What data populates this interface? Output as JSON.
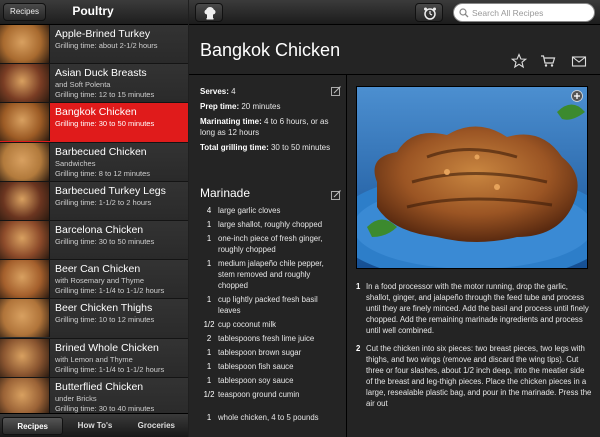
{
  "left_panel": {
    "back_label": "Recipes",
    "title": "Poultry",
    "recipes": [
      {
        "title": "Apple-Brined Turkey",
        "subtitle": "",
        "meta": "Grilling time: about 2-1/2 hours",
        "active": false,
        "thumb": "#a86a2f"
      },
      {
        "title": "Asian Duck Breasts",
        "subtitle": "and Soft Polenta",
        "meta": "Grilling time: 12 to 15 minutes",
        "active": false,
        "thumb": "#7a3d24"
      },
      {
        "title": "Bangkok Chicken",
        "subtitle": "",
        "meta": "Grilling time: 30 to 50 minutes",
        "active": true,
        "thumb": "#9c5b25"
      },
      {
        "title": "Barbecued Chicken",
        "subtitle": "Sandwiches",
        "meta": "Grilling time: 8 to 12 minutes",
        "active": false,
        "thumb": "#b27a3c"
      },
      {
        "title": "Barbecued Turkey Legs",
        "subtitle": "",
        "meta": "Grilling time: 1-1/2 to 2 hours",
        "active": false,
        "thumb": "#6b3520"
      },
      {
        "title": "Barcelona Chicken",
        "subtitle": "",
        "meta": "Grilling time: 30 to 50 minutes",
        "active": false,
        "thumb": "#8c4a2a"
      },
      {
        "title": "Beer Can Chicken",
        "subtitle": "with Rosemary and Thyme",
        "meta": "Grilling time: 1-1/4 to 1-1/2 hours",
        "active": false,
        "thumb": "#a45f2c"
      },
      {
        "title": "Beer Chicken Thighs",
        "subtitle": "",
        "meta": "Grilling time: 10 to 12 minutes",
        "active": false,
        "thumb": "#b0743a"
      },
      {
        "title": "Brined Whole Chicken",
        "subtitle": "with Lemon and Thyme",
        "meta": "Grilling time: 1-1/4 to 1-1/2 hours",
        "active": false,
        "thumb": "#8a5530"
      },
      {
        "title": "Butterflied Chicken",
        "subtitle": "under Bricks",
        "meta": "Grilling time: 30 to 40 minutes",
        "active": false,
        "thumb": "#9a6236"
      }
    ],
    "tabs": [
      {
        "label": "Recipes",
        "selected": true
      },
      {
        "label": "How To's",
        "selected": false
      },
      {
        "label": "Groceries",
        "selected": false
      }
    ]
  },
  "toolbar": {
    "search_placeholder": "Search All Recipes"
  },
  "recipe": {
    "title": "Bangkok Chicken",
    "serves_label": "Serves:",
    "serves_value": "4",
    "prep_label": "Prep time:",
    "prep_value": "20 minutes",
    "marinating_label": "Marinating time:",
    "marinating_value": "4 to 6 hours, or as long as 12 hours",
    "grilling_label": "Total grilling time:",
    "grilling_value": "30 to 50 minutes",
    "marinade_title": "Marinade",
    "ingredients": [
      {
        "qty": "4",
        "text": "large garlic cloves"
      },
      {
        "qty": "1",
        "text": "large shallot, roughly chopped"
      },
      {
        "qty": "1",
        "text": "one-inch piece of fresh ginger, roughly chopped"
      },
      {
        "qty": "1",
        "text": "medium jalapeño chile pepper, stem removed and roughly chopped"
      },
      {
        "qty": "1",
        "text": "cup lightly packed fresh basil leaves"
      },
      {
        "qty": "1/2",
        "text": "cup coconut milk"
      },
      {
        "qty": "2",
        "text": "tablespoons fresh lime juice"
      },
      {
        "qty": "1",
        "text": "tablespoon brown sugar"
      },
      {
        "qty": "1",
        "text": "tablespoon fish sauce"
      },
      {
        "qty": "1",
        "text": "tablespoon soy sauce"
      },
      {
        "qty": "1/2",
        "text": "teaspoon ground cumin"
      },
      {
        "qty": "",
        "text": ""
      },
      {
        "qty": "1",
        "text": "whole chicken, 4 to 5 pounds"
      }
    ],
    "steps": [
      {
        "num": "1",
        "text": "In a food processor with the motor running, drop the garlic, shallot, ginger, and jalapeño through the feed tube and process until they are finely minced. Add the basil and process until finely chopped. Add the remaining marinade ingredients and process until well combined."
      },
      {
        "num": "2",
        "text": "Cut the chicken into six pieces: two breast pieces, two legs with thighs, and two wings (remove and discard the wing tips). Cut three or four slashes, about 1/2 inch deep, into the meatier side of the breast and leg-thigh pieces. Place the chicken pieces in a large, resealable plastic bag, and pour in the marinade. Press the air out"
      }
    ]
  },
  "colors": {
    "accent_active": "#e01b1b",
    "plate_blue": "#1f6fb4"
  }
}
